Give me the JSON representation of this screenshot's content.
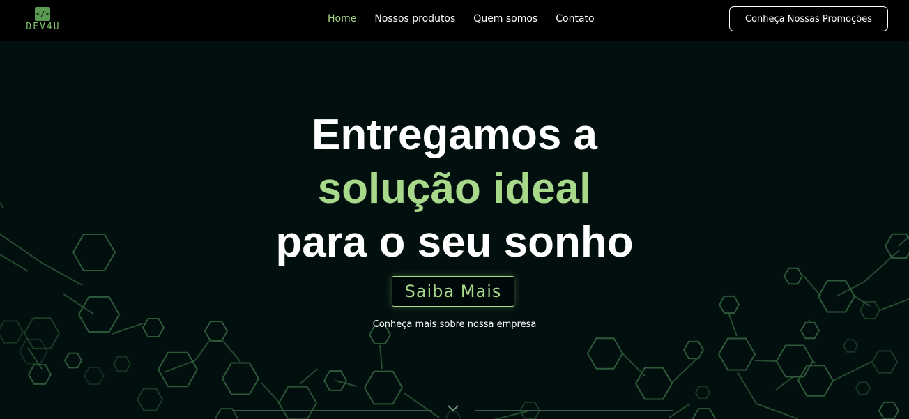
{
  "brand": {
    "logo_icon": "</>",
    "logo_text": "DEV4U"
  },
  "nav": {
    "items": [
      {
        "label": "Home",
        "active": true
      },
      {
        "label": "Nossos produtos",
        "active": false
      },
      {
        "label": "Quem somos",
        "active": false
      },
      {
        "label": "Contato",
        "active": false
      }
    ],
    "promo_label": "Conheça Nossas Promoções"
  },
  "hero": {
    "line1": "Entregamos a",
    "line2": "solução ideal",
    "line3": "para o seu sonho",
    "cta_label": "Saiba Mais",
    "subtitle": "Conheça mais sobre nossa empresa"
  },
  "icons": {
    "scroll": "chevron-down-icon",
    "pattern": "hexagon-network-pattern"
  },
  "colors": {
    "background": "#010f0e",
    "navbar": "#000000",
    "accent": "#a8d88a",
    "pattern": "#2f5a3a"
  }
}
